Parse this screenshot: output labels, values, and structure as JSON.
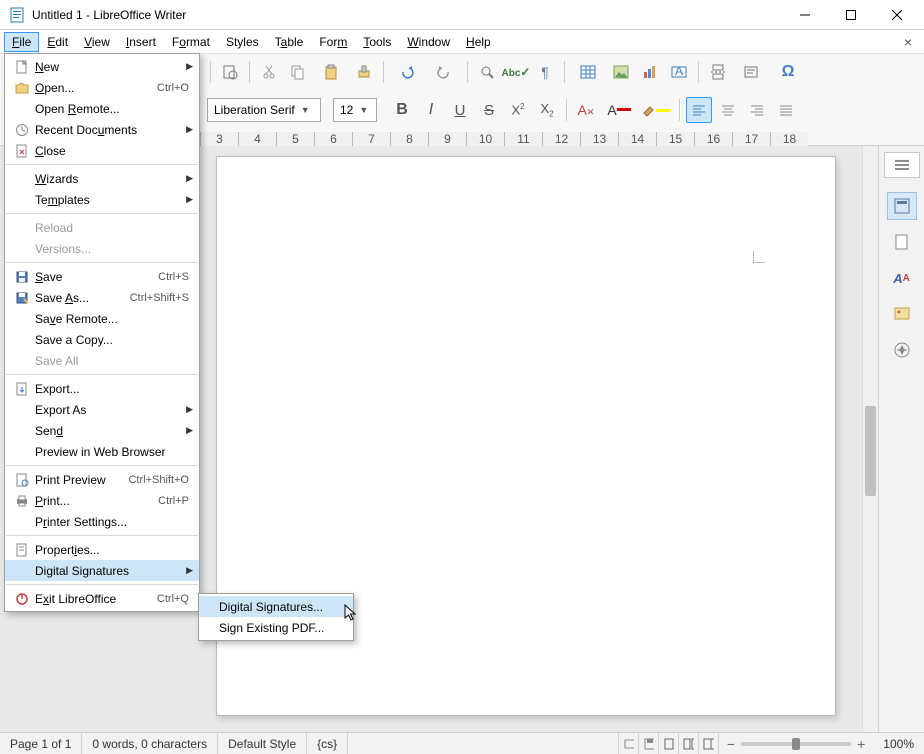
{
  "window": {
    "title": "Untitled 1 - LibreOffice Writer"
  },
  "menubar": {
    "items": [
      "File",
      "Edit",
      "View",
      "Insert",
      "Format",
      "Styles",
      "Table",
      "Form",
      "Tools",
      "Window",
      "Help"
    ],
    "active": "File"
  },
  "toolbar2": {
    "font_name": "Liberation Serif",
    "font_size": "12"
  },
  "ruler": {
    "marks": [
      "3",
      "4",
      "5",
      "6",
      "7",
      "8",
      "9",
      "10",
      "11",
      "12",
      "13",
      "14",
      "15",
      "16",
      "17",
      "18"
    ]
  },
  "filemenu": {
    "new": "New",
    "open": "Open...",
    "open_accel": "Ctrl+O",
    "open_remote": "Open Remote...",
    "recent": "Recent Documents",
    "close": "Close",
    "wizards": "Wizards",
    "templates": "Templates",
    "reload": "Reload",
    "versions": "Versions...",
    "save": "Save",
    "save_accel": "Ctrl+S",
    "save_as": "Save As...",
    "save_as_accel": "Ctrl+Shift+S",
    "save_remote": "Save Remote...",
    "save_copy": "Save a Copy...",
    "save_all": "Save All",
    "export": "Export...",
    "export_as": "Export As",
    "send": "Send",
    "preview_web": "Preview in Web Browser",
    "print_preview": "Print Preview",
    "print_preview_accel": "Ctrl+Shift+O",
    "print": "Print...",
    "print_accel": "Ctrl+P",
    "printer_settings": "Printer Settings...",
    "properties": "Properties...",
    "digital_sig": "Digital Signatures",
    "exit": "Exit LibreOffice",
    "exit_accel": "Ctrl+Q"
  },
  "submenu": {
    "digital_sig": "Digital Signatures...",
    "sign_pdf": "Sign Existing PDF..."
  },
  "statusbar": {
    "page": "Page 1 of 1",
    "words": "0 words, 0 characters",
    "style": "Default Style",
    "lang": "{cs}",
    "zoom": "100%"
  }
}
